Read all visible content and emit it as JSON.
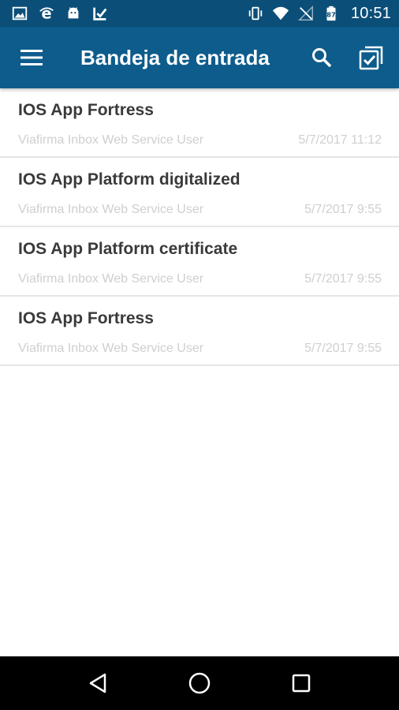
{
  "status_bar": {
    "time": "10:51",
    "left_icons": [
      "image-icon",
      "browser-e-icon",
      "android-icon",
      "app-check-icon"
    ],
    "right_icons": [
      "vibrate-icon",
      "wifi-icon",
      "no-signal-icon",
      "battery-icon"
    ]
  },
  "app_bar": {
    "title": "Bandeja de entrada",
    "background": "#0d5c8c",
    "menu_icon": "menu-icon",
    "search_icon": "search-icon",
    "select_icon": "multi-select-icon"
  },
  "inbox": {
    "items": [
      {
        "title": "IOS App Fortress",
        "sender": "Viafirma Inbox Web Service User",
        "date": "5/7/2017 11:12"
      },
      {
        "title": "IOS App Platform digitalized",
        "sender": "Viafirma Inbox Web Service User",
        "date": "5/7/2017 9:55"
      },
      {
        "title": "IOS App Platform certificate",
        "sender": "Viafirma Inbox Web Service User",
        "date": "5/7/2017 9:55"
      },
      {
        "title": "IOS App Fortress",
        "sender": "Viafirma Inbox Web Service User",
        "date": "5/7/2017 9:55"
      }
    ]
  },
  "nav_bar": {
    "icons": [
      "back-icon",
      "home-icon",
      "recents-icon"
    ]
  }
}
